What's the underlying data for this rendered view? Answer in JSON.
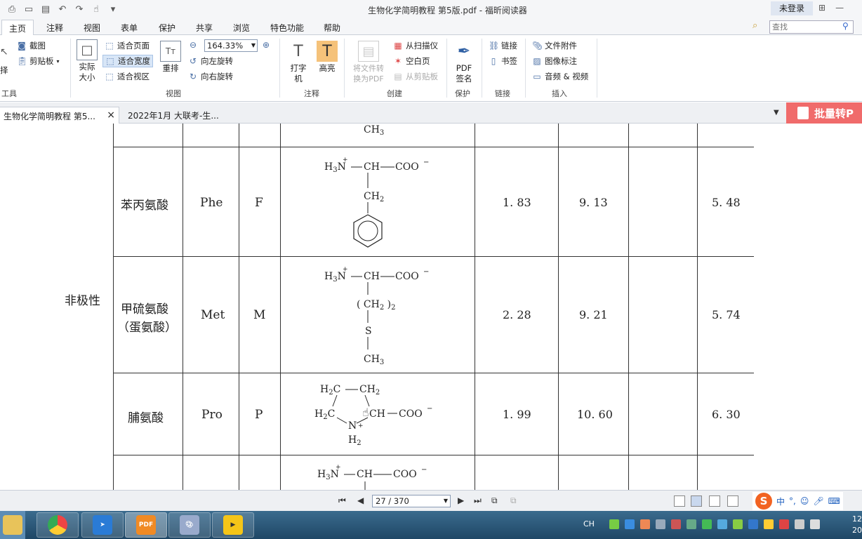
{
  "window": {
    "title": "生物化学简明教程 第5版.pdf - 福昕阅读器",
    "login": "未登录"
  },
  "menu": {
    "tabs": [
      "主页",
      "注释",
      "视图",
      "表单",
      "保护",
      "共享",
      "浏览",
      "特色功能",
      "帮助"
    ],
    "search_placeholder": "查找"
  },
  "ribbon": {
    "tools": {
      "select_fragment": "择",
      "screenshot": "截图",
      "clipboard": "剪贴板",
      "label": "工具"
    },
    "view": {
      "actual_size": "实际大小",
      "fit_page": "适合页面",
      "fit_width": "适合宽度",
      "fit_view": "适合视区",
      "reflow": "重排",
      "zoom_value": "164.33%",
      "rotate_left": "向左旋转",
      "rotate_right": "向右旋转",
      "label": "视图"
    },
    "comment": {
      "typewriter": "打字机",
      "highlight": "高亮",
      "label": "注释"
    },
    "create": {
      "to_pdf": "将文件转换为PDF",
      "from_scanner": "从扫描仪",
      "blank_page": "空白页",
      "from_clipboard": "从剪贴板",
      "label": "创建"
    },
    "protect": {
      "pdf_sign": "PDF签名",
      "label": "保护"
    },
    "links": {
      "link": "链接",
      "bookmark": "书签",
      "label": "链接"
    },
    "insert": {
      "file_attachment": "文件附件",
      "image_annotation": "图像标注",
      "audio_video": "音频 & 视频",
      "label": "插入"
    }
  },
  "doc_tabs": [
    {
      "label": "生物化学简明教程 第5...",
      "active": true
    },
    {
      "label": "2022年1月 大联考-生...",
      "active": false
    }
  ],
  "batch_button": "批量转P",
  "document": {
    "group_label": "非极性",
    "top_fragment": "CH3",
    "rows": [
      {
        "name": "苯丙氨酸",
        "abbr3": "Phe",
        "abbr1": "F",
        "pk1": "1. 83",
        "pk2": "9. 13",
        "pkr": "",
        "pi": "5. 48"
      },
      {
        "name": "甲硫氨酸",
        "name_alt": "（蛋氨酸）",
        "abbr3": "Met",
        "abbr1": "M",
        "pk1": "2. 28",
        "pk2": "9. 21",
        "pkr": "",
        "pi": "5. 74"
      },
      {
        "name": "脯氨酸",
        "abbr3": "Pro",
        "abbr1": "P",
        "pk1": "1. 99",
        "pk2": "10. 60",
        "pkr": "",
        "pi": "6. 30"
      }
    ]
  },
  "status": {
    "page_indicator": "27 / 370"
  },
  "ime": {
    "mode": "中"
  },
  "taskbar": {
    "tray_text": "CH",
    "clock_line1": "12",
    "clock_line2": "20"
  }
}
